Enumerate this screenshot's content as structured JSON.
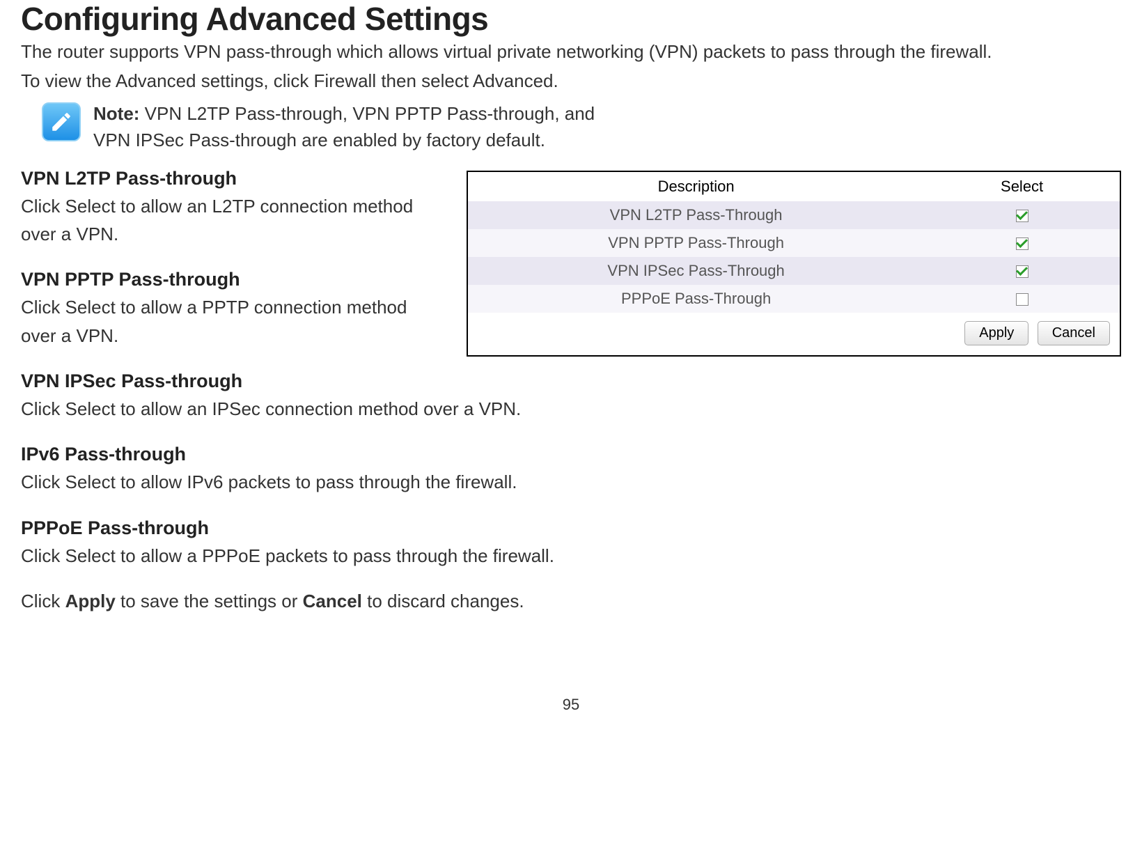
{
  "title": "Configuring Advanced Settings",
  "intro1": "The router supports VPN pass-through which allows virtual private networking (VPN) packets to pass through the firewall.",
  "intro2": "To view the Advanced settings, click Firewall then select Advanced.",
  "note": {
    "label": "Note:",
    "line1": " VPN L2TP Pass-through, VPN PPTP Pass-through, and",
    "line2": "VPN IPSec Pass-through are enabled by factory default."
  },
  "sections": [
    {
      "title": "VPN L2TP Pass-through",
      "body": "Click Select to allow an L2TP connection method over a VPN."
    },
    {
      "title": "VPN PPTP Pass-through",
      "body": "Click Select to allow a PPTP connection method over a VPN."
    },
    {
      "title": "VPN IPSec Pass-through",
      "body": "Click Select to allow an IPSec connection method over a VPN."
    },
    {
      "title": "IPv6 Pass-through",
      "body": "Click Select to allow IPv6 packets to pass through the firewall."
    },
    {
      "title": "PPPoE Pass-through",
      "body": "Click Select to allow a PPPoE packets to pass through the firewall."
    }
  ],
  "apply_line": {
    "pre": "Click ",
    "apply": "Apply",
    "mid": " to save the settings or ",
    "cancel": "Cancel",
    "post": " to discard changes."
  },
  "panel": {
    "headers": {
      "description": "Description",
      "select": "Select"
    },
    "rows": [
      {
        "description": "VPN L2TP Pass-Through",
        "checked": true
      },
      {
        "description": "VPN PPTP Pass-Through",
        "checked": true
      },
      {
        "description": "VPN IPSec Pass-Through",
        "checked": true
      },
      {
        "description": "PPPoE Pass-Through",
        "checked": false
      }
    ],
    "buttons": {
      "apply": "Apply",
      "cancel": "Cancel"
    }
  },
  "page_number": "95"
}
